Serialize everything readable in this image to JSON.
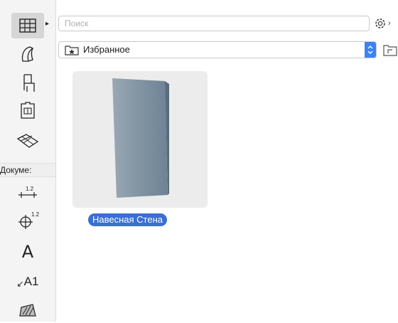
{
  "toolbar": {
    "section_label": "Докуме:",
    "dimension_value": "1.2",
    "text_tool_glyph": "A",
    "label_tool_glyph": "A1",
    "active_tool": "curtain-wall"
  },
  "search": {
    "placeholder": "Поиск",
    "value": ""
  },
  "folder": {
    "selected": "Избранное"
  },
  "items": [
    {
      "label": "Навесная Стена",
      "selected": true
    }
  ],
  "colors": {
    "accent": "#3a6fd0",
    "dropdown_accent": "#3b82f6",
    "thumbnail_bg": "#ececec"
  }
}
